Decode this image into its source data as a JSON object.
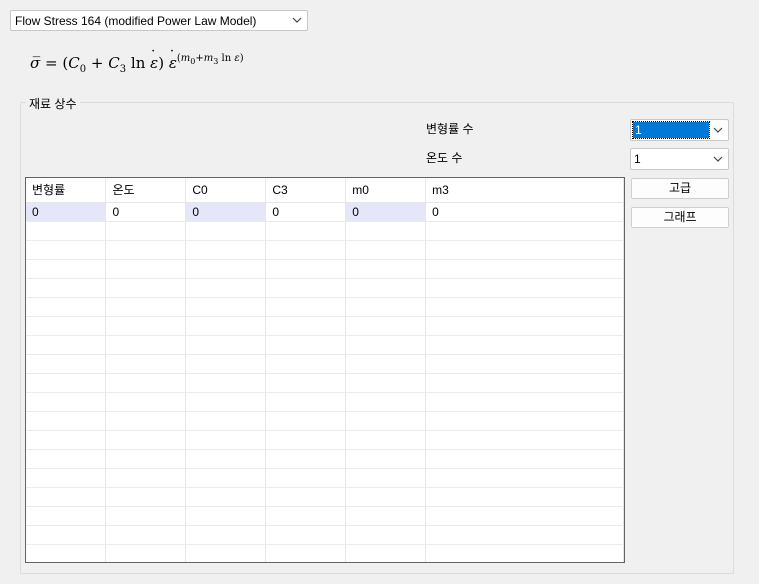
{
  "model": {
    "selected": "Flow Stress 164 (modified Power Law Model)"
  },
  "formula": {
    "sigma": "σ̅",
    "eq": "=",
    "lhs": "(C",
    "c0_sub": "0",
    "plus": " + C",
    "c3_sub": "3",
    "ln": " ln ",
    "eps": "ε",
    "close": ")",
    "exp_open": "(m",
    "m0_sub": "0",
    "exp_plus": "+m",
    "m3_sub": "3",
    "exp_ln": " ln ",
    "exp_close": ")"
  },
  "group": {
    "title": "재료 상수"
  },
  "strain_count": {
    "label": "변형률 수",
    "value": "1"
  },
  "temp_count": {
    "label": "온도 수",
    "value": "1"
  },
  "buttons": {
    "advanced": "고급",
    "graph": "그래프"
  },
  "table": {
    "columns": [
      "변형률",
      "온도",
      "C0",
      "C3",
      "m0",
      "m3"
    ],
    "rows": [
      [
        "0",
        "0",
        "0",
        "0",
        "0",
        "0"
      ]
    ]
  }
}
